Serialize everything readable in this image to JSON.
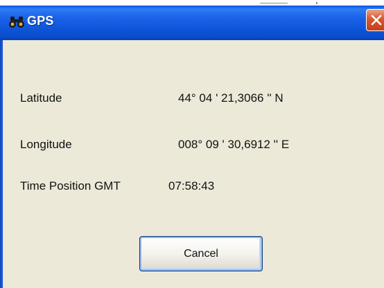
{
  "window": {
    "title": "GPS",
    "title_icon": "binoculars-icon",
    "close_icon": "close-icon"
  },
  "fields": {
    "latitude": {
      "label": "Latitude",
      "value": "44° 04 ' 21,3066 '' N"
    },
    "longitude": {
      "label": "Longitude",
      "value": "008° 09 ' 30,6912 '' E"
    },
    "time": {
      "label": "Time Position GMT",
      "value": "07:58:43"
    }
  },
  "buttons": {
    "cancel_label": "Cancel"
  },
  "colors": {
    "titlebar": "#0a4ccb",
    "dialog_background": "#ece9d8",
    "close_button": "#d8562f"
  }
}
